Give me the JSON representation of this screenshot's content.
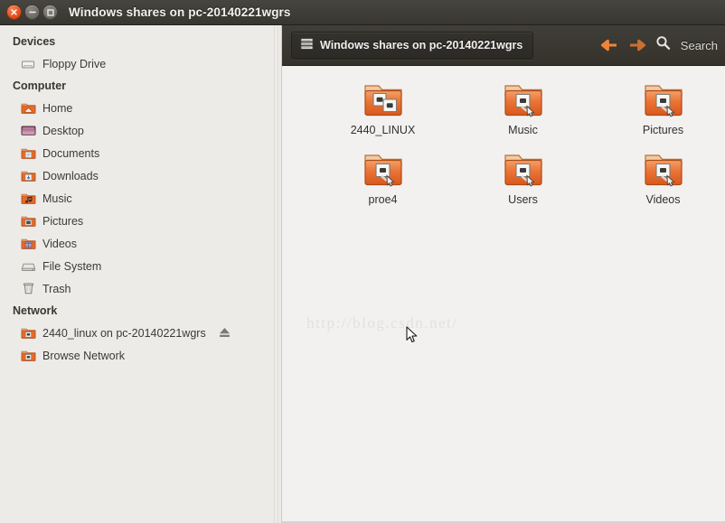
{
  "window": {
    "title": "Windows shares on pc-20140221wgrs",
    "buttons": [
      {
        "name": "close",
        "icon": "close-icon",
        "label": "×"
      },
      {
        "name": "minimize",
        "icon": "minimize-icon",
        "label": "−"
      },
      {
        "name": "maximize",
        "icon": "maximize-icon",
        "label": "□"
      }
    ]
  },
  "sidebar": {
    "sections": [
      {
        "heading": "Devices",
        "items": [
          {
            "label": "Floppy Drive",
            "icon": "floppy-drive-icon",
            "eject": false
          }
        ]
      },
      {
        "heading": "Computer",
        "items": [
          {
            "label": "Home",
            "icon": "home-folder-icon",
            "eject": false
          },
          {
            "label": "Desktop",
            "icon": "desktop-icon",
            "eject": false
          },
          {
            "label": "Documents",
            "icon": "documents-folder-icon",
            "eject": false
          },
          {
            "label": "Downloads",
            "icon": "downloads-folder-icon",
            "eject": false
          },
          {
            "label": "Music",
            "icon": "music-folder-icon",
            "eject": false
          },
          {
            "label": "Pictures",
            "icon": "pictures-folder-icon",
            "eject": false
          },
          {
            "label": "Videos",
            "icon": "videos-folder-icon",
            "eject": false
          },
          {
            "label": "File System",
            "icon": "harddisk-icon",
            "eject": false
          },
          {
            "label": "Trash",
            "icon": "trash-icon",
            "eject": false
          }
        ]
      },
      {
        "heading": "Network",
        "items": [
          {
            "label": "2440_linux on pc-20140221wgrs",
            "icon": "network-share-icon",
            "eject": true
          },
          {
            "label": "Browse Network",
            "icon": "network-share-icon",
            "eject": false
          }
        ]
      }
    ]
  },
  "toolbar": {
    "breadcrumb_label": "Windows shares on pc-20140221wgrs",
    "breadcrumb_icon": "server-icon",
    "back_icon": "arrow-left-icon",
    "forward_icon": "arrow-right-icon",
    "search_icon": "search-icon",
    "search_label": "Search"
  },
  "content": {
    "items": [
      {
        "label": "2440_LINUX",
        "icon": "network-share-folder-icon"
      },
      {
        "label": "Music",
        "icon": "network-share-folder-icon"
      },
      {
        "label": "Pictures",
        "icon": "network-share-folder-icon"
      },
      {
        "label": "proe4",
        "icon": "network-share-folder-icon"
      },
      {
        "label": "Users",
        "icon": "network-share-folder-icon"
      },
      {
        "label": "Videos",
        "icon": "network-share-folder-icon"
      }
    ],
    "watermark": "http://blog.csdn.net/"
  },
  "colors": {
    "titlebar": "#3c3a34",
    "sidebar": "#edebe7",
    "content_bg": "#f2f1f0",
    "accent_orange": "#dd4814",
    "folder_orange": "#e8692a"
  }
}
